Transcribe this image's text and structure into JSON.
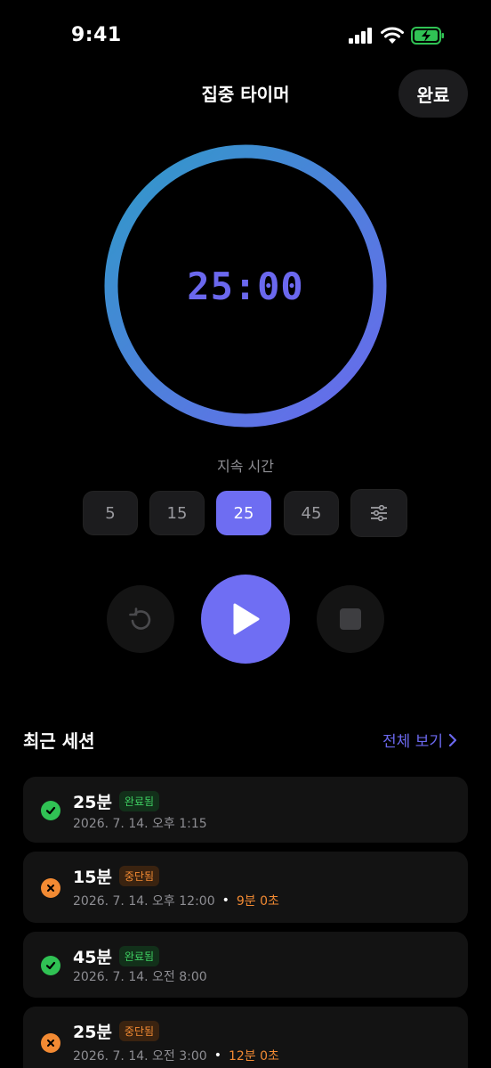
{
  "status": {
    "time": "9:41"
  },
  "header": {
    "title": "집중 타이머",
    "done_label": "완료"
  },
  "timer": {
    "display": "25:00",
    "progress": 1.0,
    "gradient_start": "#6b68ee",
    "gradient_end": "#2f9ac8"
  },
  "duration": {
    "label": "지속 시간",
    "options": [
      "5",
      "15",
      "25",
      "45"
    ],
    "selected": "25",
    "custom_icon": "sliders-icon"
  },
  "controls": {
    "reset_icon": "reset-icon",
    "play_icon": "play-icon",
    "stop_icon": "stop-icon"
  },
  "recent": {
    "title": "최근 세션",
    "see_all": "전체 보기",
    "sessions": [
      {
        "duration": "25분",
        "status": "완료됨",
        "status_type": "ok",
        "date": "2026. 7. 14. 오후 1:15",
        "elapsed": ""
      },
      {
        "duration": "15분",
        "status": "중단됨",
        "status_type": "stop",
        "date": "2026. 7. 14. 오후 12:00",
        "elapsed": "9분 0초"
      },
      {
        "duration": "45분",
        "status": "완료됨",
        "status_type": "ok",
        "date": "2026. 7. 14. 오전 8:00",
        "elapsed": ""
      },
      {
        "duration": "25분",
        "status": "중단됨",
        "status_type": "stop",
        "date": "2026. 7. 14. 오전 3:00",
        "elapsed": "12분 0초"
      }
    ]
  },
  "colors": {
    "accent": "#6e6df2",
    "success": "#30c254",
    "warning": "#f28a33"
  }
}
